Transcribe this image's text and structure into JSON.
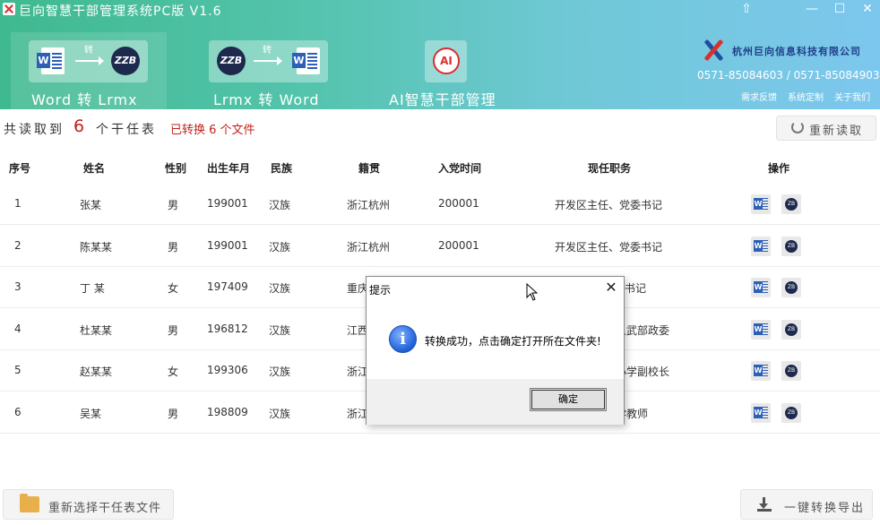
{
  "window": {
    "title": "巨向智慧干部管理系统PC版 V1.6",
    "controls": [
      "⇧",
      "—",
      "☐",
      "✕"
    ]
  },
  "modes": [
    {
      "label": "Word 转 Lrmx",
      "arrow_text": "转",
      "active": true
    },
    {
      "label": "Lrmx 转 Word",
      "arrow_text": "转",
      "active": false
    },
    {
      "label": "AI智慧干部管理",
      "icon_text": "AI",
      "active": false
    }
  ],
  "brand": {
    "name": "杭州巨向信息科技有限公司",
    "phone": "0571-85084603 / 0571-85084903",
    "links": [
      "需求反馈",
      "系统定制",
      "关于我们"
    ]
  },
  "summary": {
    "read_prefix": "共读取到",
    "read_count": "6",
    "read_suffix": "个干任表",
    "converted": "已转换 6 个文件",
    "reload_label": "重新读取"
  },
  "table": {
    "headers": [
      "序号",
      "姓名",
      "性别",
      "出生年月",
      "民族",
      "籍贯",
      "入党时间",
      "现任职务",
      "操作"
    ],
    "rows": [
      [
        "1",
        "张某",
        "男",
        "199001",
        "汉族",
        "浙江杭州",
        "200001",
        "开发区主任、党委书记"
      ],
      [
        "2",
        "陈某某",
        "男",
        "199001",
        "汉族",
        "浙江杭州",
        "200001",
        "开发区主任、党委书记"
      ],
      [
        "3",
        "丁 某",
        "女",
        "197409",
        "汉族",
        "重庆",
        "",
        "书记"
      ],
      [
        "4",
        "杜某某",
        "男",
        "196812",
        "汉族",
        "江西",
        "",
        "人武部政委"
      ],
      [
        "5",
        "赵某某",
        "女",
        "199306",
        "汉族",
        "浙江",
        "",
        "小学副校长"
      ],
      [
        "6",
        "吴某",
        "男",
        "198809",
        "汉族",
        "浙江",
        "",
        "学教师"
      ]
    ]
  },
  "bottom": {
    "reselect_label": "重新选择干任表文件",
    "export_label": "一键转换导出"
  },
  "dialog": {
    "title": "提示",
    "message": "转换成功，点击确定打开所在文件夹!",
    "ok_label": "确定",
    "close_glyph": "✕",
    "info_glyph": "i"
  },
  "colors": {
    "header_start": "#3fb98f",
    "header_end": "#7dc7ee",
    "count_red": "#c0201c",
    "converted_red": "#c0201c",
    "word_blue": "#2b5fb8"
  }
}
